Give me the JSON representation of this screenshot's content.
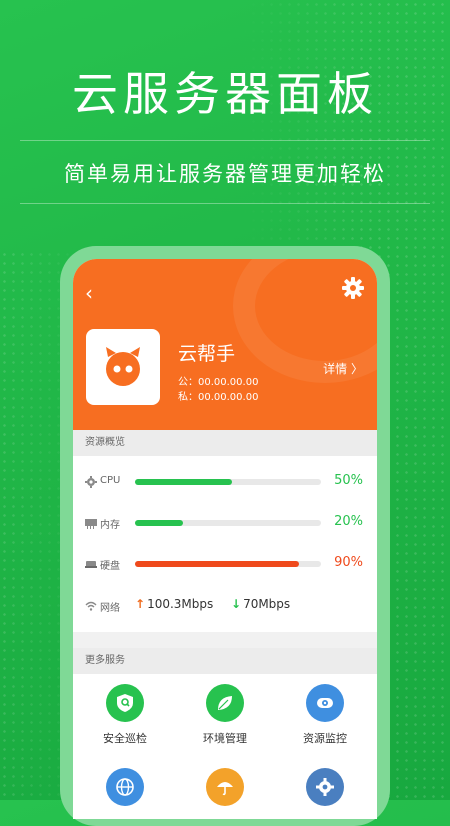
{
  "hero": {
    "title": "云服务器面板",
    "subtitle": "简单易用让服务器管理更加轻松"
  },
  "app": {
    "header_color": "#f76e21",
    "name": "云帮手",
    "public_ip": "公：00.00.00.00",
    "private_ip": "私：00.00.00.00",
    "details_label": "详情 〉",
    "back_icon": "back-chevron-icon",
    "settings_icon": "gear-icon"
  },
  "resources": {
    "section_title": "资源概览",
    "rows": [
      {
        "label": "CPU",
        "icon": "chip-icon",
        "percent_text": "50%",
        "fraction": 0.52,
        "color": "#27c24f"
      },
      {
        "label": "内存",
        "icon": "memory-icon",
        "percent_text": "20%",
        "fraction": 0.26,
        "color": "#27c24f"
      },
      {
        "label": "硬盘",
        "icon": "disk-icon",
        "percent_text": "90%",
        "fraction": 0.88,
        "color": "#ef4a1c"
      }
    ],
    "network": {
      "label": "网络",
      "upload": "100.3Mbps",
      "download": "70Mbps",
      "upload_color": "#ef6a1c",
      "download_color": "#27c24f"
    }
  },
  "services": {
    "section_title": "更多服务",
    "items": [
      {
        "label": "安全巡检",
        "icon": "shield-search-icon",
        "color": "#27c24f"
      },
      {
        "label": "环境管理",
        "icon": "leaf-icon",
        "color": "#27c24f"
      },
      {
        "label": "资源监控",
        "icon": "camera-monitor-icon",
        "color": "#3f8fe0"
      },
      {
        "label": "",
        "icon": "globe-icon",
        "color": "#3f8fe0"
      },
      {
        "label": "",
        "icon": "umbrella-icon",
        "color": "#f3a22a"
      },
      {
        "label": "",
        "icon": "gear-service-icon",
        "color": "#4a7fc0"
      }
    ]
  }
}
